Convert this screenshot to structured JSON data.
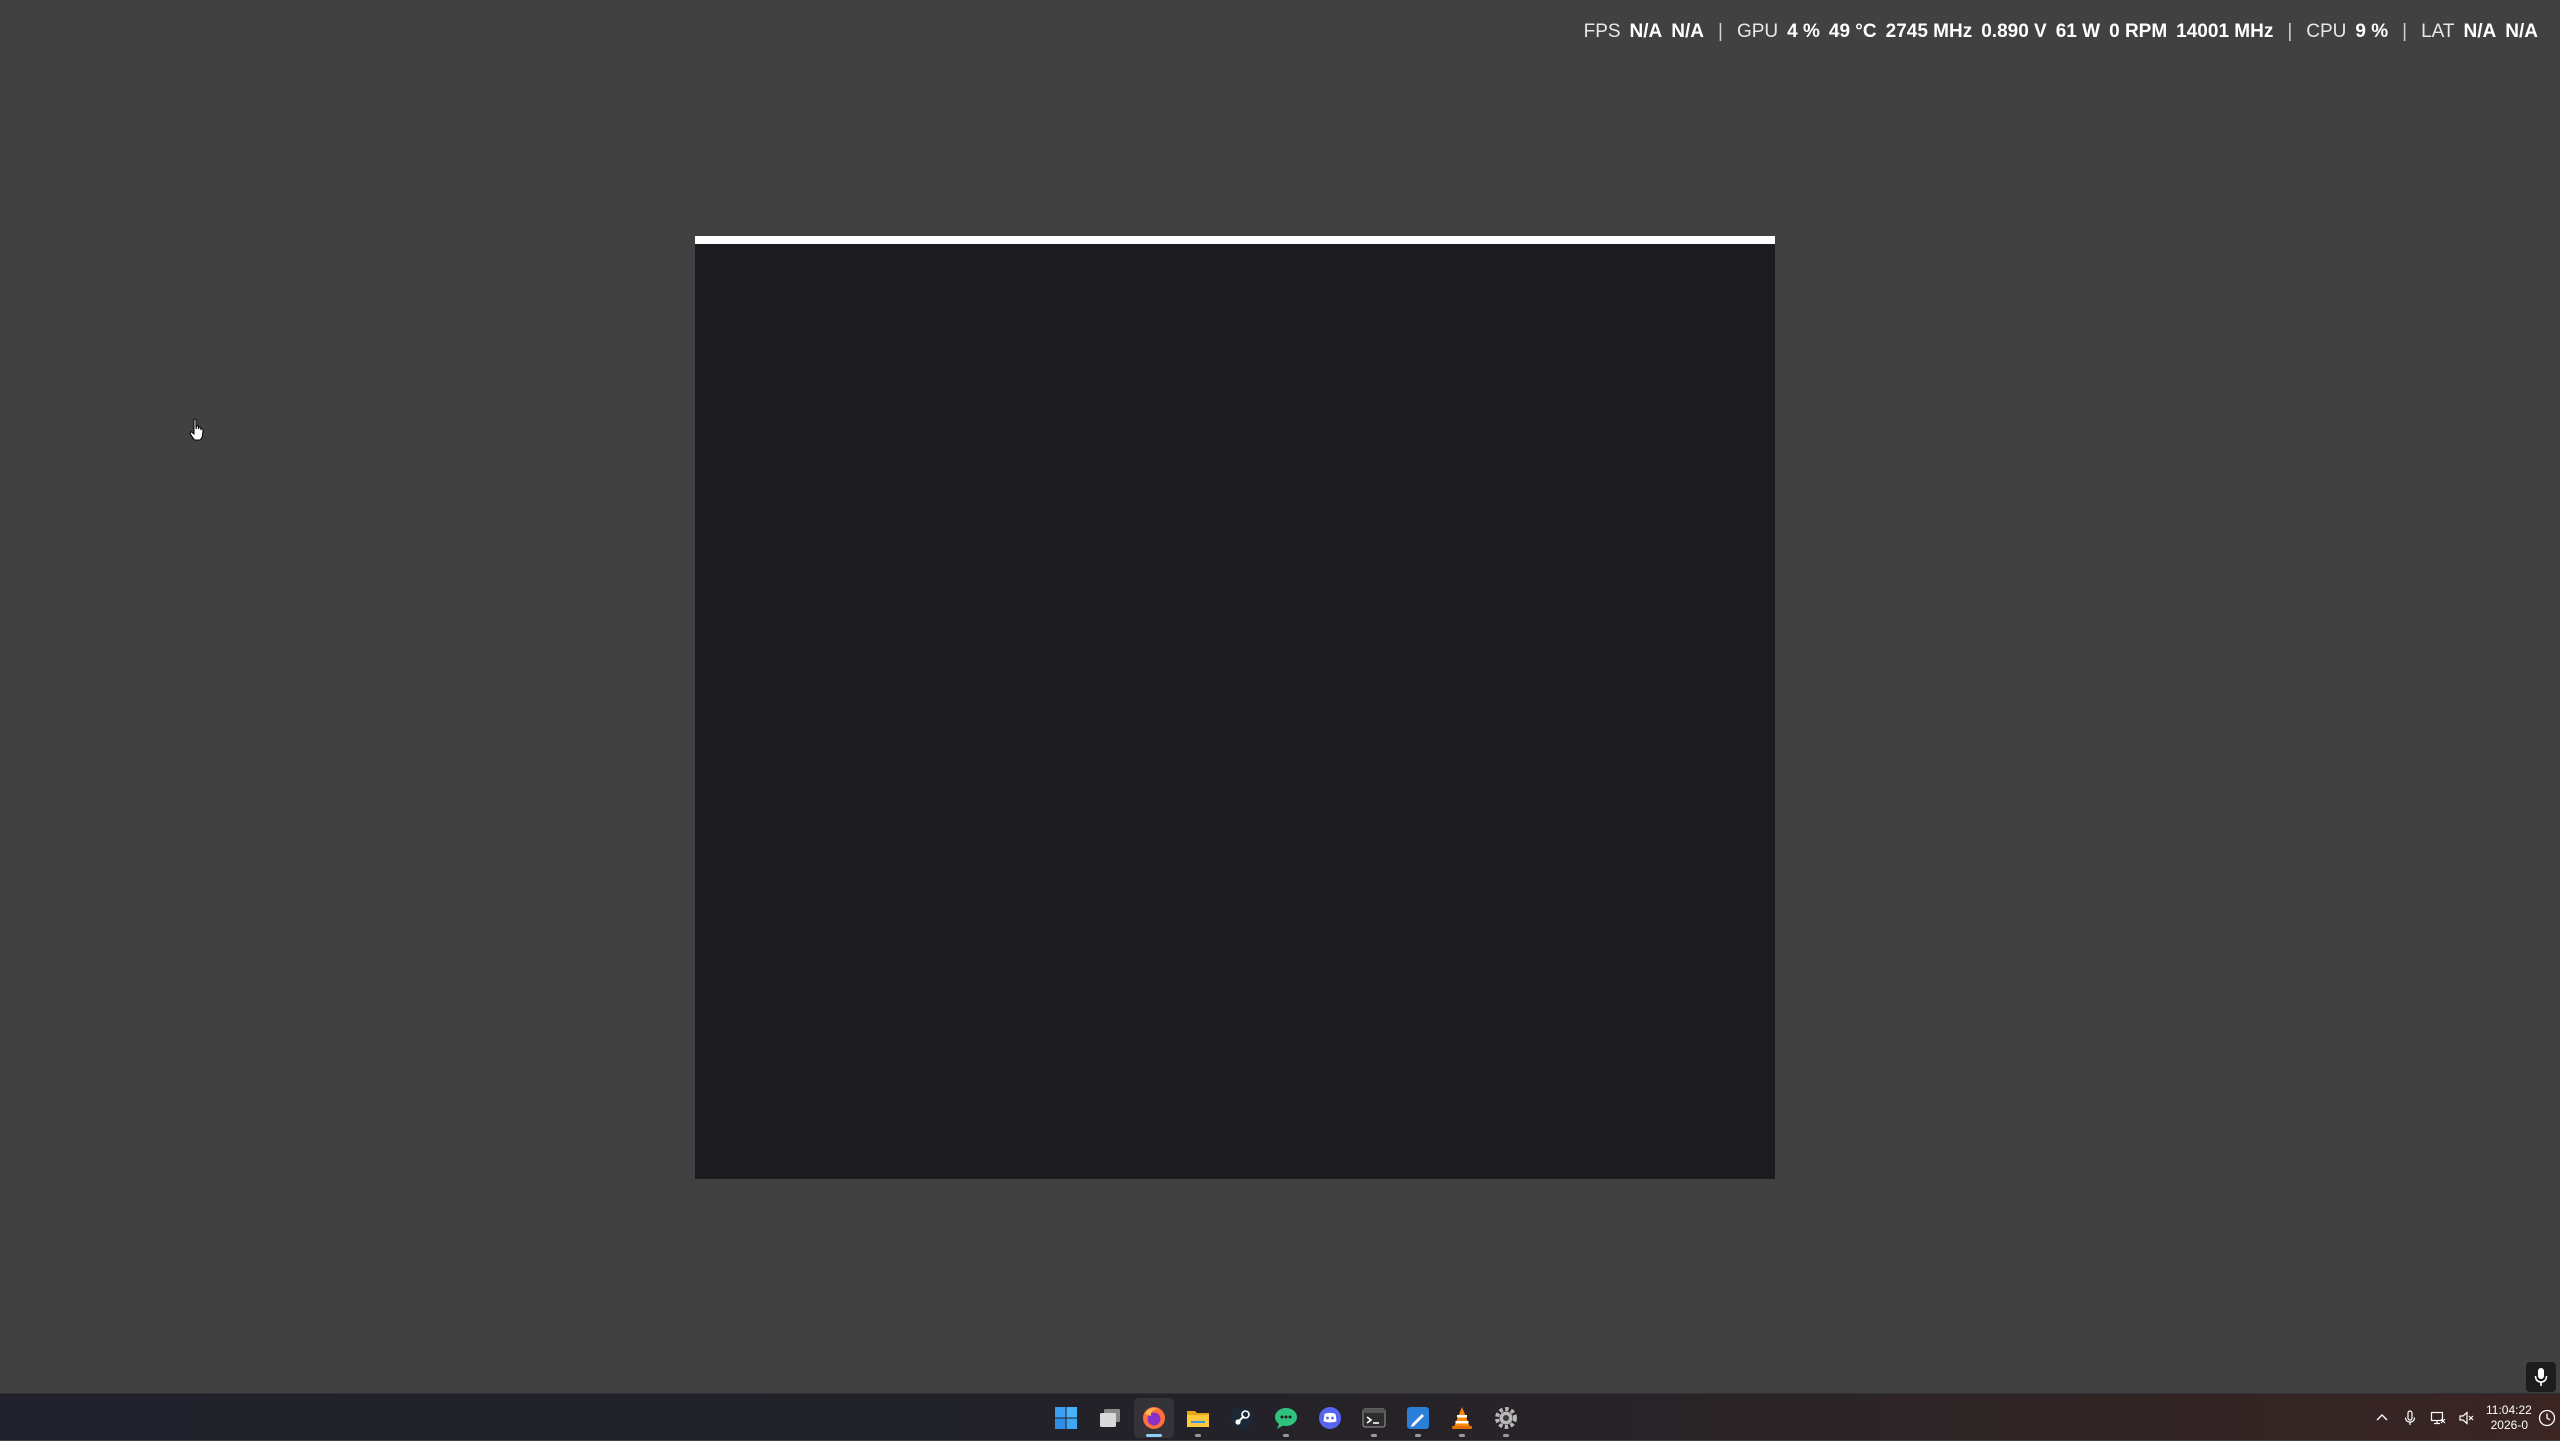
{
  "overlay": {
    "fps_label": "FPS",
    "fps_value_1": "N/A",
    "fps_value_2": "N/A",
    "gpu_label": "GPU",
    "gpu_load": "4 %",
    "gpu_temp": "49 °C",
    "gpu_clock": "2745 MHz",
    "gpu_voltage": "0.890 V",
    "gpu_power": "61 W",
    "gpu_fan": "0 RPM",
    "gpu_mem_clock": "14001 MHz",
    "cpu_label": "CPU",
    "cpu_load": "9 %",
    "lat_label": "LAT",
    "lat_value_1": "N/A",
    "lat_value_2": "N/A",
    "separator": "|"
  },
  "taskbar": {
    "apps": [
      {
        "name": "Start",
        "icon": "windows-start-icon",
        "active": false,
        "running": false
      },
      {
        "name": "Task View",
        "icon": "task-view-icon",
        "active": false,
        "running": false
      },
      {
        "name": "Firefox",
        "icon": "firefox-icon",
        "active": true,
        "running": true
      },
      {
        "name": "File Explorer",
        "icon": "file-explorer-icon",
        "active": false,
        "running": true
      },
      {
        "name": "Steam",
        "icon": "steam-icon",
        "active": false,
        "running": false
      },
      {
        "name": "Chat",
        "icon": "green-chat-icon",
        "active": false,
        "running": true
      },
      {
        "name": "Discord",
        "icon": "discord-icon",
        "active": false,
        "running": false
      },
      {
        "name": "Terminal",
        "icon": "terminal-icon",
        "active": false,
        "running": true
      },
      {
        "name": "Editor",
        "icon": "blue-editor-icon",
        "active": false,
        "running": true
      },
      {
        "name": "VLC",
        "icon": "vlc-icon",
        "active": false,
        "running": true
      },
      {
        "name": "Settings",
        "icon": "settings-gear-icon",
        "active": false,
        "running": true
      }
    ],
    "clock_time": "11:04:22",
    "clock_date": "2026-0",
    "accent": "#8ecdf8"
  },
  "colors": {
    "desktop": "#414141",
    "window": "#1c1b20",
    "window_bar": "#ffffff"
  }
}
